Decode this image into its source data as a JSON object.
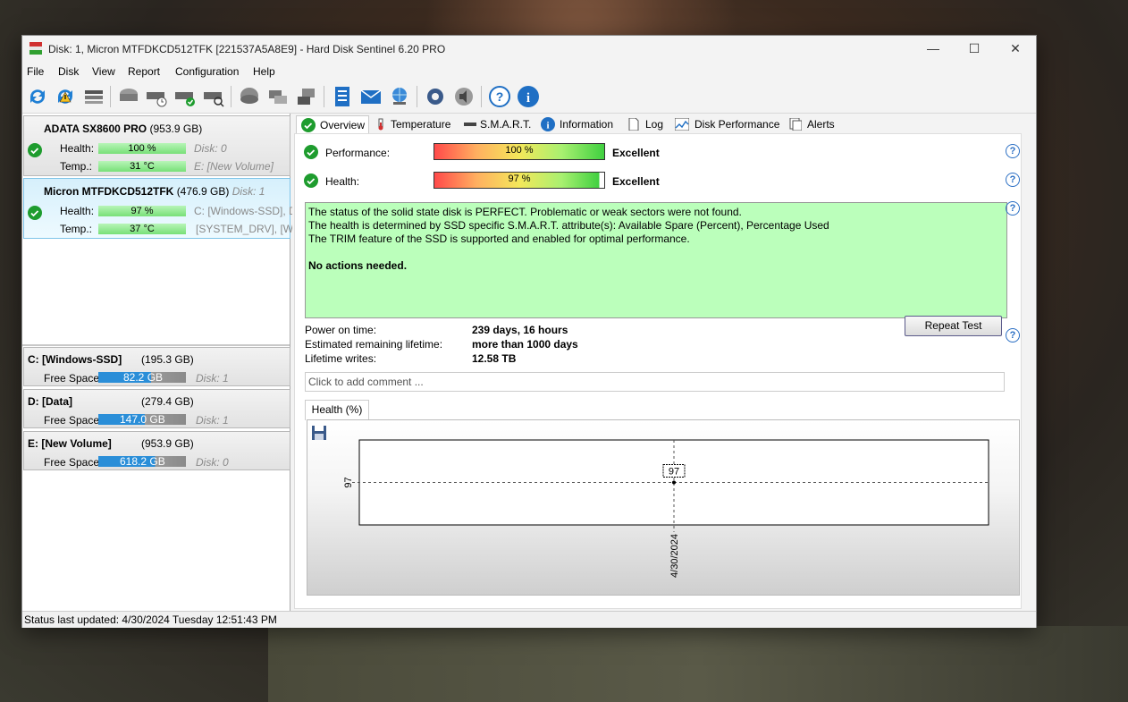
{
  "window": {
    "title": "Disk: 1, Micron MTFDKCD512TFK [221537A5A8E9]  -  Hard Disk Sentinel 6.20 PRO",
    "minimize": "—",
    "maximize": "☐",
    "close": "✕"
  },
  "menu": [
    "File",
    "Disk",
    "View",
    "Report",
    "Configuration",
    "Help"
  ],
  "disks": [
    {
      "name": "ADATA SX8600 PRO",
      "size": "(953.9 GB)",
      "disk_label": "",
      "health_label": "Health:",
      "health": "100 %",
      "health_info": "Disk: 0",
      "temp_label": "Temp.:",
      "temp": "31 °C",
      "temp_info": "E: [New Volume]"
    },
    {
      "name": "Micron MTFDKCD512TFK",
      "size": "(476.9 GB)",
      "disk_label": "Disk: 1",
      "health_label": "Health:",
      "health": "97 %",
      "health_info": "C: [Windows-SSD], D",
      "temp_label": "Temp.:",
      "temp": "37 °C",
      "temp_info": "[SYSTEM_DRV], [WI"
    }
  ],
  "volumes": [
    {
      "name": "C: [Windows-SSD]",
      "size": "(195.3 GB)",
      "free_label": "Free Space",
      "free": "82.2 GB",
      "disk": "Disk: 1"
    },
    {
      "name": "D: [Data]",
      "size": "(279.4 GB)",
      "free_label": "Free Space",
      "free": "147.0 GB",
      "disk": "Disk: 1"
    },
    {
      "name": "E: [New Volume]",
      "size": "(953.9 GB)",
      "free_label": "Free Space",
      "free": "618.2 GB",
      "disk": "Disk: 0"
    }
  ],
  "tabs": [
    "Overview",
    "Temperature",
    "S.M.A.R.T.",
    "Information",
    "Log",
    "Disk Performance",
    "Alerts"
  ],
  "overview": {
    "performance_label": "Performance:",
    "performance_value": "100 %",
    "performance_rating": "Excellent",
    "health_label": "Health:",
    "health_value": "97 %",
    "health_rating": "Excellent",
    "status_lines": [
      "The status of the solid state disk is PERFECT. Problematic or weak sectors were not found.",
      "The health is determined by SSD specific S.M.A.R.T. attribute(s):  Available Spare (Percent), Percentage Used",
      "The TRIM feature of the SSD is supported and enabled for optimal performance."
    ],
    "status_action": "No actions needed.",
    "power_on_label": "Power on time:",
    "power_on_value": "239 days, 16 hours",
    "lifetime_label": "Estimated remaining lifetime:",
    "lifetime_value": "more than 1000 days",
    "writes_label": "Lifetime writes:",
    "writes_value": "12.58 TB",
    "repeat_button": "Repeat Test",
    "comment_placeholder": "Click to add comment ...",
    "graph_tab": "Health (%)"
  },
  "chart_data": {
    "type": "scatter",
    "x": [
      "4/30/2024"
    ],
    "series": [
      {
        "values": [
          97
        ]
      }
    ],
    "ytick_labels": [
      "97"
    ],
    "xtick_labels": [
      "4/30/2024"
    ],
    "data_labels": [
      "97"
    ]
  },
  "statusbar": "Status last updated: 4/30/2024 Tuesday 12:51:43 PM",
  "colors": {
    "ok_green": "#1e9c2e",
    "accent_blue": "#2a8ed8",
    "status_bg": "#bbffbb"
  }
}
